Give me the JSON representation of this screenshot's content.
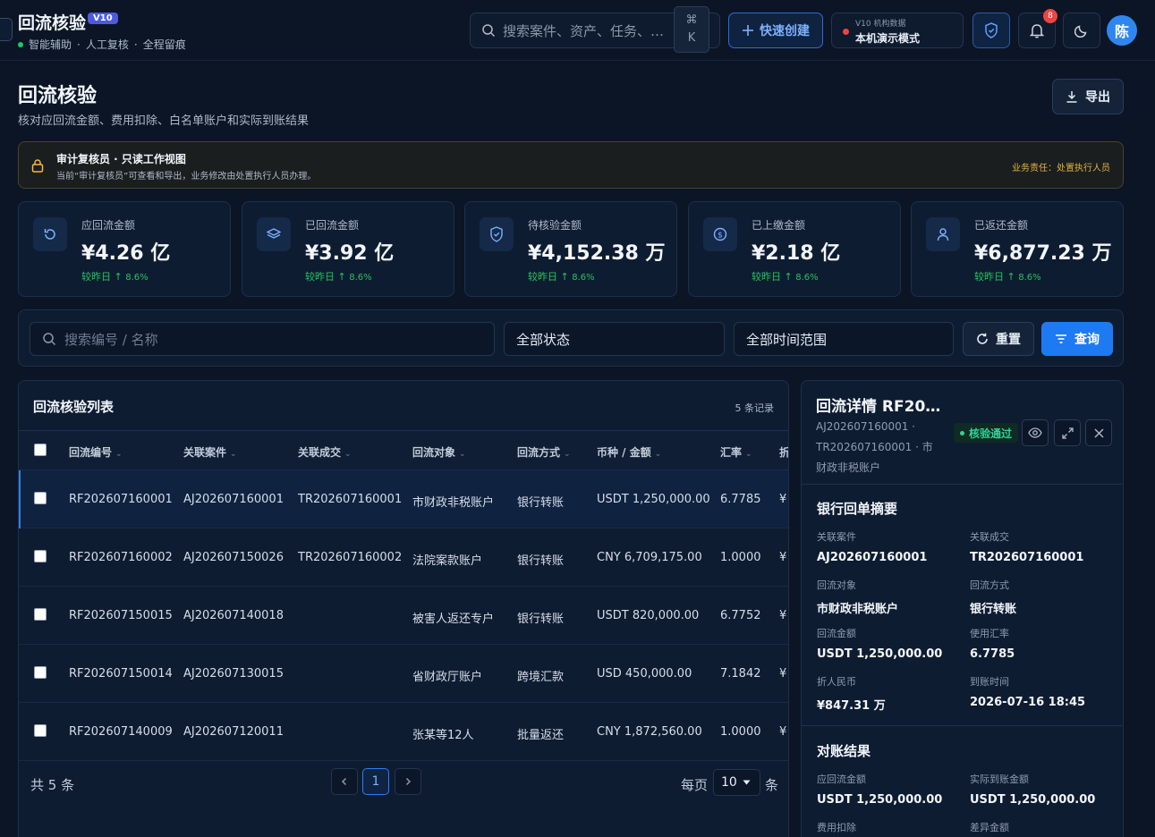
{
  "header": {
    "title": "回流核验",
    "version": "V10",
    "subtitle_items": [
      "智能辅助",
      "人工复核",
      "全程留痕"
    ],
    "search_placeholder": "搜索案件、资产、任务、…",
    "shortcut_symbol": "⌘",
    "shortcut_key": "K",
    "quick_create": "快速创建",
    "org_small": "V10 机构数据",
    "org_main": "本机演示模式",
    "notification_count": "8",
    "avatar_text": "陈"
  },
  "page": {
    "title": "回流核验",
    "description": "核对应回流金额、费用扣除、白名单账户和实际到账结果",
    "export_label": "导出"
  },
  "notice": {
    "title": "审计复核员 · 只读工作视图",
    "desc": "当前“审计复核员”可查看和导出，业务修改由处置执行人员办理。",
    "right": "业务责任：处置执行人员"
  },
  "stats": [
    {
      "label": "应回流金额",
      "value": "¥4.26 亿",
      "change_prefix": "较昨日 ↑",
      "change_pct": "8.6%",
      "icon": "rotate-icon"
    },
    {
      "label": "已回流金额",
      "value": "¥3.92 亿",
      "change_prefix": "较昨日 ↑",
      "change_pct": "8.6%",
      "icon": "layers-icon"
    },
    {
      "label": "待核验金额",
      "value": "¥4,152.38 万",
      "change_prefix": "较昨日 ↑",
      "change_pct": "8.6%",
      "icon": "shield-check-icon"
    },
    {
      "label": "已上缴金额",
      "value": "¥2.18 亿",
      "change_prefix": "较昨日 ↑",
      "change_pct": "8.6%",
      "icon": "coin-icon"
    },
    {
      "label": "已返还金额",
      "value": "¥6,877.23 万",
      "change_prefix": "较昨日 ↑",
      "change_pct": "8.6%",
      "icon": "user-icon"
    }
  ],
  "filters": {
    "search_placeholder": "搜索编号 / 名称",
    "status": "全部状态",
    "time_range": "全部时间范围",
    "reset": "重置",
    "query": "查询"
  },
  "list": {
    "title": "回流核验列表",
    "count": "5 条记录",
    "columns": [
      "回流编号",
      "关联案件",
      "关联成交",
      "回流对象",
      "回流方式",
      "币种 / 金额",
      "汇率",
      "折"
    ],
    "rows": [
      {
        "id": "RF202607160001",
        "case": "AJ202607160001",
        "deal": "TR202607160001",
        "target": "市财政非税账户",
        "method": "银行转账",
        "amount": "USDT 1,250,000.00",
        "rate": "6.7785",
        "cny": "¥"
      },
      {
        "id": "RF202607160002",
        "case": "AJ202607150026",
        "deal": "TR202607160002",
        "target": "法院案款账户",
        "method": "银行转账",
        "amount": "CNY 6,709,175.00",
        "rate": "1.0000",
        "cny": "¥"
      },
      {
        "id": "RF202607150015",
        "case": "AJ202607140018",
        "deal": "",
        "target": "被害人返还专户",
        "method": "银行转账",
        "amount": "USDT 820,000.00",
        "rate": "6.7752",
        "cny": "¥"
      },
      {
        "id": "RF202607150014",
        "case": "AJ202607130015",
        "deal": "",
        "target": "省财政厅账户",
        "method": "跨境汇款",
        "amount": "USD 450,000.00",
        "rate": "7.1842",
        "cny": "¥"
      },
      {
        "id": "RF202607140009",
        "case": "AJ202607120011",
        "deal": "",
        "target": "张某等12人",
        "method": "批量返还",
        "amount": "CNY 1,872,560.00",
        "rate": "1.0000",
        "cny": "¥"
      }
    ],
    "total": "共 5 条",
    "current_page": "1",
    "per_page_label": "每页",
    "per_page": "10",
    "per_page_unit": "条"
  },
  "detail": {
    "title": "回流详情 RF20…",
    "meta_case": "AJ202607160001 ·",
    "meta_deal": "TR202607160001 · 市",
    "meta_target": "财政非税账户",
    "status": "核验通过",
    "section1": "银行回单摘要",
    "fields1": [
      {
        "label": "关联案件",
        "value": "AJ202607160001"
      },
      {
        "label": "关联成交",
        "value": "TR202607160001"
      },
      {
        "label": "回流对象",
        "value": "市财政非税账户"
      },
      {
        "label": "回流方式",
        "value": "银行转账"
      },
      {
        "label": "回流金额",
        "value": "USDT 1,250,000.00"
      },
      {
        "label": "使用汇率",
        "value": "6.7785"
      },
      {
        "label": "折人民币",
        "value": "¥847.31 万"
      },
      {
        "label": "到账时间",
        "value": "2026-07-16 18:45"
      }
    ],
    "section2": "对账结果",
    "fields2": [
      {
        "label": "应回流金额",
        "value": "USDT 1,250,000.00"
      },
      {
        "label": "实际到账金额",
        "value": "USDT 1,250,000.00"
      },
      {
        "label": "费用扣除",
        "value": ""
      },
      {
        "label": "差异金额",
        "value": ""
      }
    ]
  }
}
